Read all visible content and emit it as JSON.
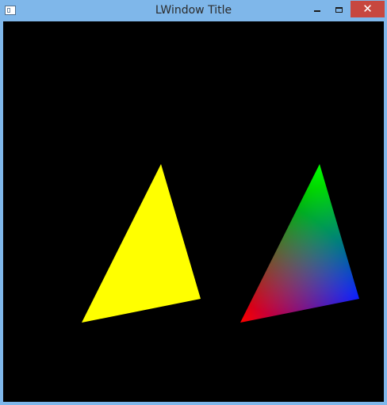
{
  "window": {
    "title": "LWindow Title",
    "app_icon": "window-app-icon",
    "controls": {
      "minimize_icon": "minimize-icon",
      "maximize_icon": "maximize-icon",
      "close_icon": "close-icon",
      "close_glyph": "✕",
      "close_color": "#c7473f"
    }
  },
  "scene": {
    "background": "#000000",
    "left_triangle": {
      "fill": "#ffff00"
    },
    "right_triangle": {
      "vertex_colors": [
        "#ff0000",
        "#00ff00",
        "#0000ff"
      ]
    }
  }
}
